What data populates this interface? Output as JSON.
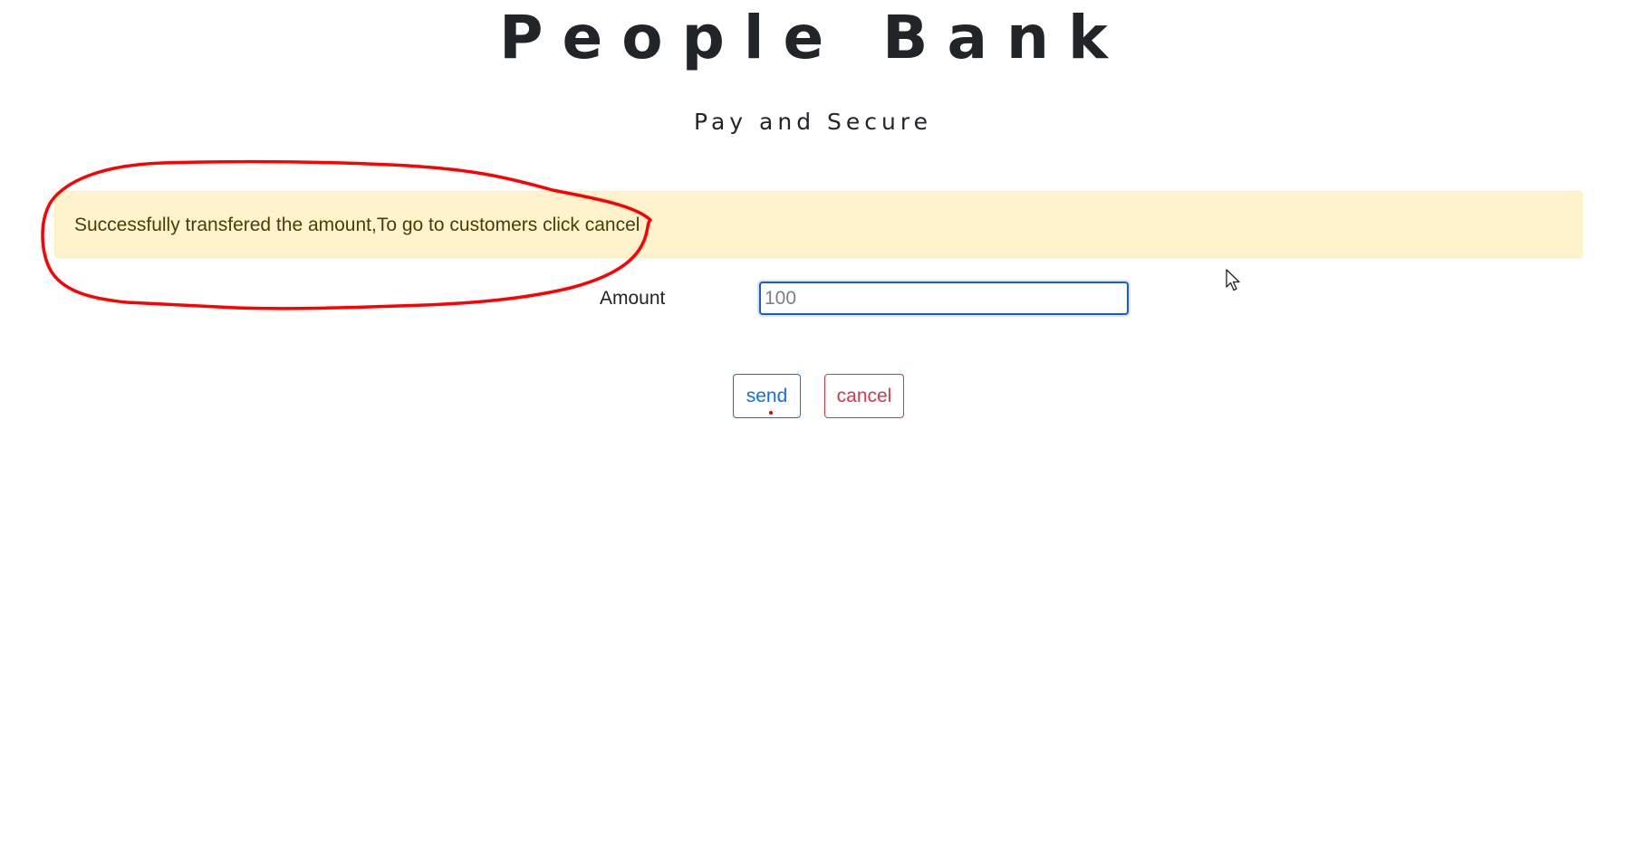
{
  "header": {
    "title": "People Bank",
    "subtitle": "Pay and Secure"
  },
  "alert": {
    "message": "Successfully transfered the amount,To go to customers click cancel",
    "background": "#fff3cd"
  },
  "form": {
    "amount_label": "Amount",
    "amount_placeholder": "100",
    "amount_value": ""
  },
  "buttons": {
    "send_label": "send",
    "cancel_label": "cancel"
  },
  "colors": {
    "primary": "#0d6efd",
    "danger": "#dc3545",
    "annotation": "#ff0000"
  },
  "icons": {
    "cursor": "mouse-pointer-icon"
  }
}
